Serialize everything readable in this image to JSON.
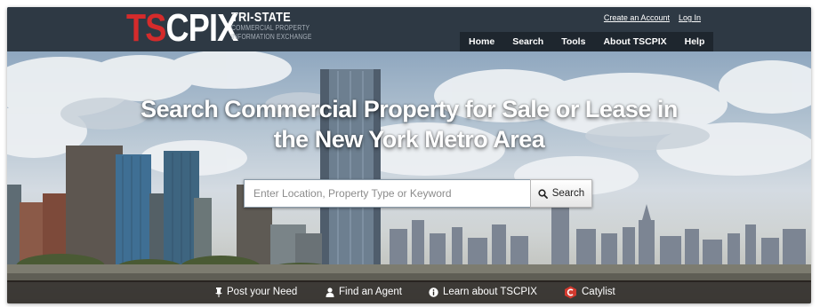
{
  "logo": {
    "mark_red": "TS",
    "mark_white": "CPIX",
    "title": "TRI-STATE",
    "subtitle_line1": "COMMERCIAL PROPERTY",
    "subtitle_line2": "INFORMATION EXCHANGE"
  },
  "account": {
    "create_account": "Create an Account",
    "log_in": "Log In"
  },
  "nav": {
    "items": [
      {
        "label": "Home"
      },
      {
        "label": "Search"
      },
      {
        "label": "Tools"
      },
      {
        "label": "About TSCPIX"
      },
      {
        "label": "Help"
      }
    ]
  },
  "hero": {
    "title": "Search Commercial Property for Sale or Lease in the New York Metro Area"
  },
  "search": {
    "placeholder": "Enter Location, Property Type or Keyword",
    "value": "",
    "button_label": "Search",
    "button_icon": "search-icon"
  },
  "bottom_links": [
    {
      "label": "Post your Need",
      "icon": "pin-icon"
    },
    {
      "label": "Find an Agent",
      "icon": "person-icon"
    },
    {
      "label": "Learn about TSCPIX",
      "icon": "info-icon"
    },
    {
      "label": "Catylist",
      "icon": "catylist-logo-icon"
    }
  ],
  "colors": {
    "header_bg": "#2e3944",
    "nav_bg": "#1e262e",
    "logo_red": "#d52b2b",
    "catylist_red": "#d23a2f"
  }
}
